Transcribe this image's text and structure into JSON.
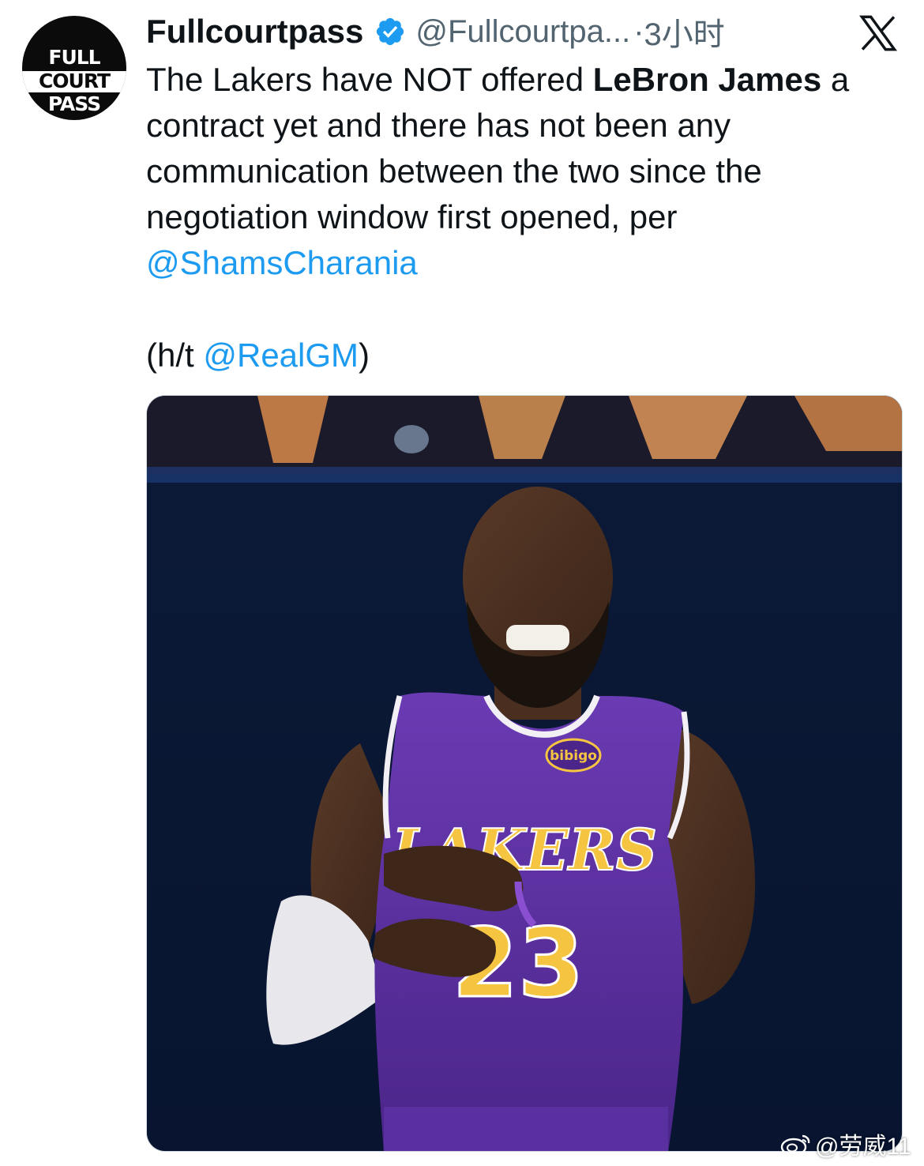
{
  "author": {
    "display_name": "Fullcourtpass",
    "handle": "@Fullcourtpa...",
    "separator": "·",
    "time": "3小时",
    "avatar_text": [
      "FULL",
      "COURT",
      "PASS"
    ],
    "verified": true
  },
  "platform_icon": "x-logo-icon",
  "tweet": {
    "text_before": "The Lakers have NOT offered ",
    "bold": "LeBron James",
    "text_after": " a contract yet and there has not been any communication between the two since the negotiation window first opened, per ",
    "mention1": "@ShamsCharania",
    "ht_open": "(h/t ",
    "mention2": "@RealGM",
    "ht_close": ")"
  },
  "media": {
    "jersey_text": "LAKERS",
    "jersey_number": "23",
    "sponsor_patch": "bibigo"
  },
  "watermark": {
    "text": "@劳威11"
  },
  "colors": {
    "link": "#1d9bf0",
    "verified": "#1d9bf0",
    "text": "#0f1419",
    "secondary": "#536471",
    "jersey": "#5b2f9e",
    "jersey_trim": "#f5c542"
  }
}
